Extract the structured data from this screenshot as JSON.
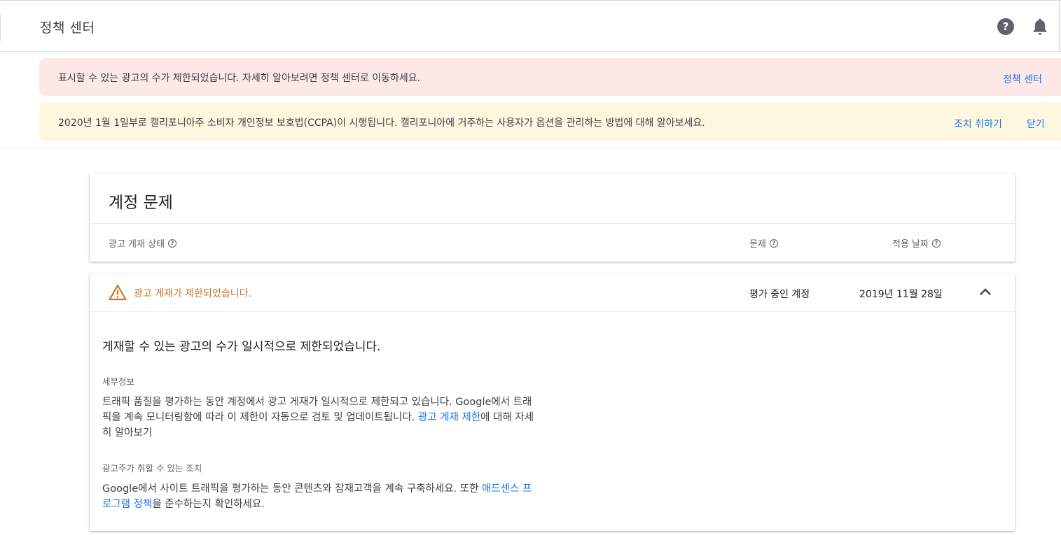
{
  "app": {
    "title": "정책 센터"
  },
  "header_icons": {
    "help": "help-icon",
    "notifications": "bell-icon"
  },
  "banners": {
    "limit": {
      "message": "표시할 수 있는 광고의 수가 제한되었습니다. 자세히 알아보려면 정책 센터로 이동하세요.",
      "link": "정책 센터"
    },
    "ccpa": {
      "message": "2020년 1월 1일부로 캘리포니아주 소비자 개인정보 보호법(CCPA)이 시행됩니다. 캘리포니아에 거주하는 사용자가 옵션을 관리하는 방법에 대해 알아보세요.",
      "action": "조치 취하기",
      "dismiss": "닫기"
    }
  },
  "account_issues": {
    "title": "계정 문제",
    "columns": {
      "status": "광고 게재 상태",
      "problem": "문제",
      "date": "적용 날짜"
    }
  },
  "issue": {
    "title": "광고 게재가 제한되었습니다.",
    "problem": "평가 중인 계정",
    "date": "2019년 11월 28일",
    "headline": "게재할 수 있는 광고의 수가 일시적으로 제한되었습니다.",
    "details_label": "세부정보",
    "details_text": "트래픽 품질을 평가하는 동안 계정에서 광고 게재가 일시적으로 제한되고 있습니다. Google에서 트래픽을 계속 모니터링함에 따라 이 제한이 자동으로 검토 및 업데이트됩니다. ",
    "details_link": "광고 게재 제한",
    "details_suffix": "에 대해 자세히 알아보기",
    "actions_label": "광고주가 취할 수 있는 조치",
    "actions_text": "Google에서 사이트 트래픽을 평가하는 동안 콘텐츠와 잠재고객을 계속 구축하세요. 또한 ",
    "actions_link": "애드센스 프로그램 정책",
    "actions_suffix": "을 준수하는지 확인하세요."
  },
  "colors": {
    "accent_link": "#1a73e8",
    "warning": "#c5762a",
    "error_banner": "#fce8e6",
    "info_banner": "#fef7e0"
  }
}
